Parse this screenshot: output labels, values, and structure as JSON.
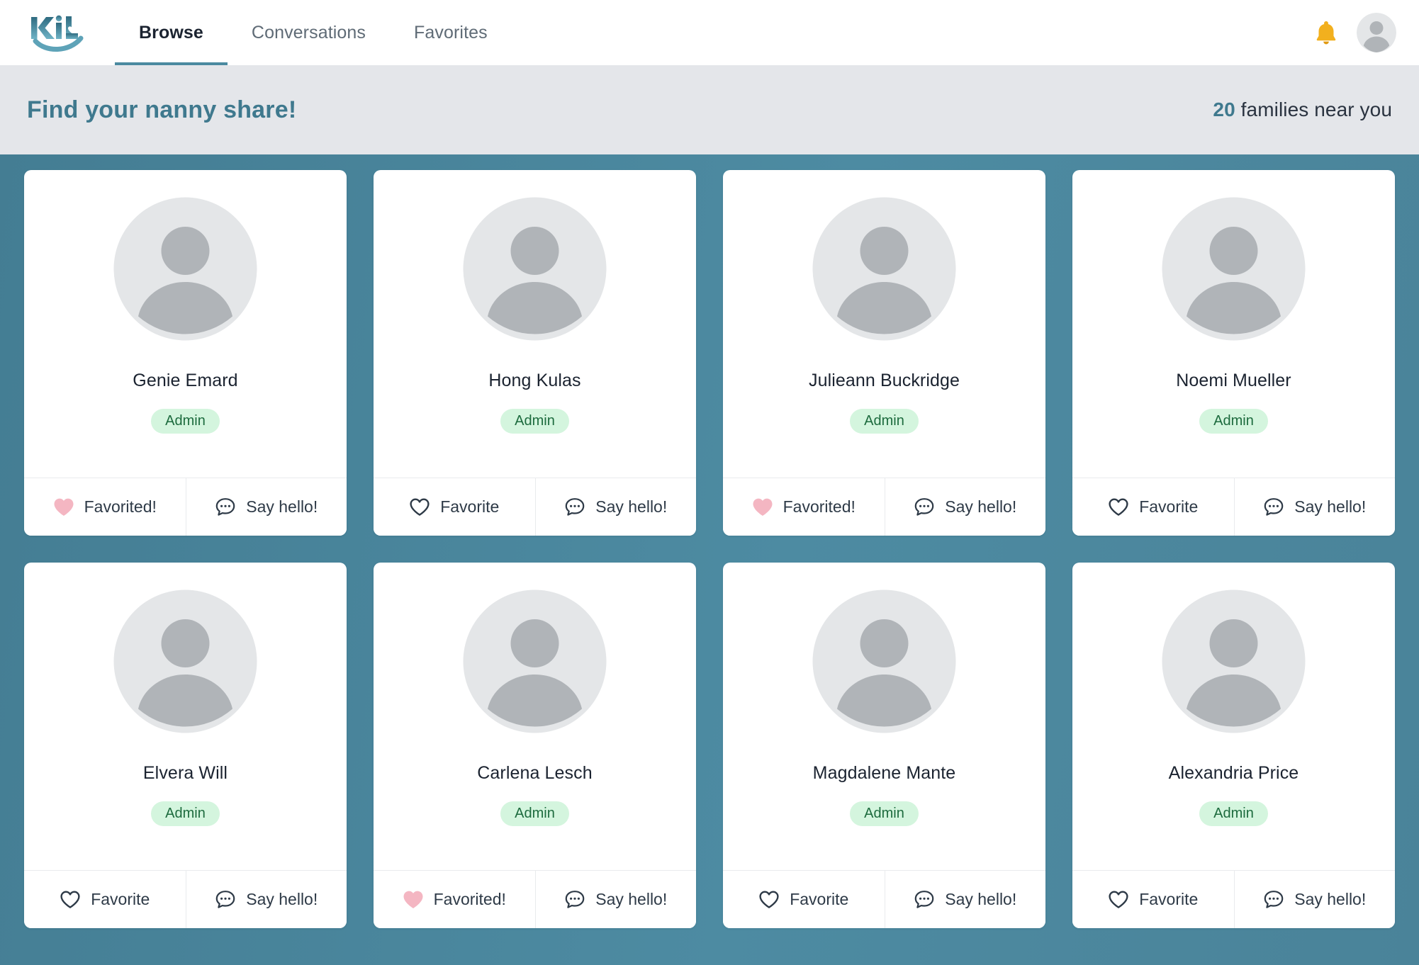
{
  "header": {
    "logo_text": "KidL",
    "logo_name": "kidl-logo",
    "nav": [
      {
        "label": "Browse",
        "active": true
      },
      {
        "label": "Conversations",
        "active": false
      },
      {
        "label": "Favorites",
        "active": false
      }
    ],
    "notifications_icon": "bell-icon",
    "account_icon": "user-avatar-icon"
  },
  "subheader": {
    "title": "Find your nanny share!",
    "count": "20",
    "count_suffix": " families near you"
  },
  "colors": {
    "brand_teal": "#3f798e",
    "main_background": "#4a8399",
    "subheader_background": "#e4e6ea",
    "badge_background": "#d4f5de",
    "badge_text": "#1d6b3e",
    "favorited_heart": "#f4b6c2",
    "text_dark": "#2e3a47"
  },
  "labels": {
    "favorite": "Favorite",
    "favorited": "Favorited!",
    "say_hello": "Say hello!",
    "badge_admin": "Admin"
  },
  "cards": [
    {
      "name": "Genie Emard",
      "badge": "Admin",
      "favorite_label": "Favorited!",
      "favorited": true,
      "message_label": "Say hello!"
    },
    {
      "name": "Hong Kulas",
      "badge": "Admin",
      "favorite_label": "Favorite",
      "favorited": false,
      "message_label": "Say hello!"
    },
    {
      "name": "Julieann Buckridge",
      "badge": "Admin",
      "favorite_label": "Favorited!",
      "favorited": true,
      "message_label": "Say hello!"
    },
    {
      "name": "Noemi Mueller",
      "badge": "Admin",
      "favorite_label": "Favorite",
      "favorited": false,
      "message_label": "Say hello!"
    },
    {
      "name": "Elvera Will",
      "badge": "Admin",
      "favorite_label": "Favorite",
      "favorited": false,
      "message_label": "Say hello!"
    },
    {
      "name": "Carlena Lesch",
      "badge": "Admin",
      "favorite_label": "Favorited!",
      "favorited": true,
      "message_label": "Say hello!"
    },
    {
      "name": "Magdalene Mante",
      "badge": "Admin",
      "favorite_label": "Favorite",
      "favorited": false,
      "message_label": "Say hello!"
    },
    {
      "name": "Alexandria Price",
      "badge": "Admin",
      "favorite_label": "Favorite",
      "favorited": false,
      "message_label": "Say hello!"
    }
  ]
}
